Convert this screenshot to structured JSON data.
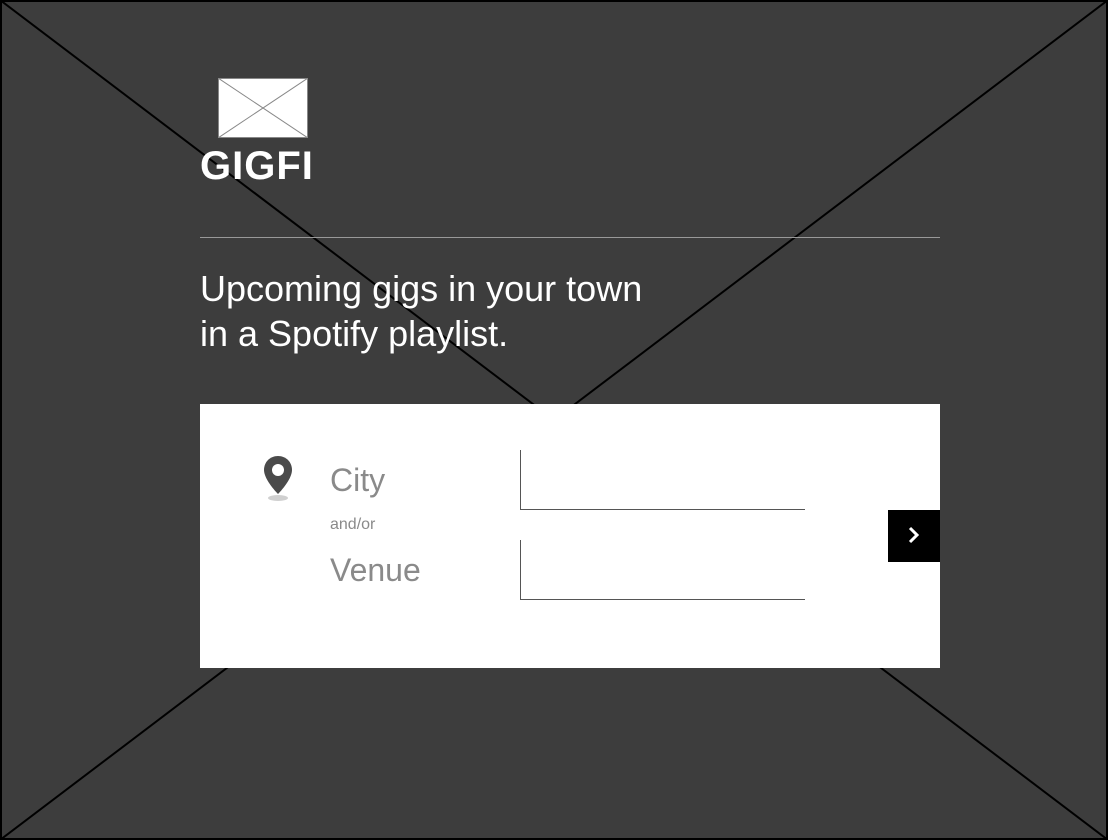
{
  "brand": {
    "name": "GIGFI"
  },
  "tagline": {
    "line1": "Upcoming gigs in your town",
    "line2": "in a Spotify playlist."
  },
  "search": {
    "city_label": "City",
    "venue_label": "Venue",
    "andor_label": "and/or",
    "city_value": "",
    "venue_value": ""
  }
}
